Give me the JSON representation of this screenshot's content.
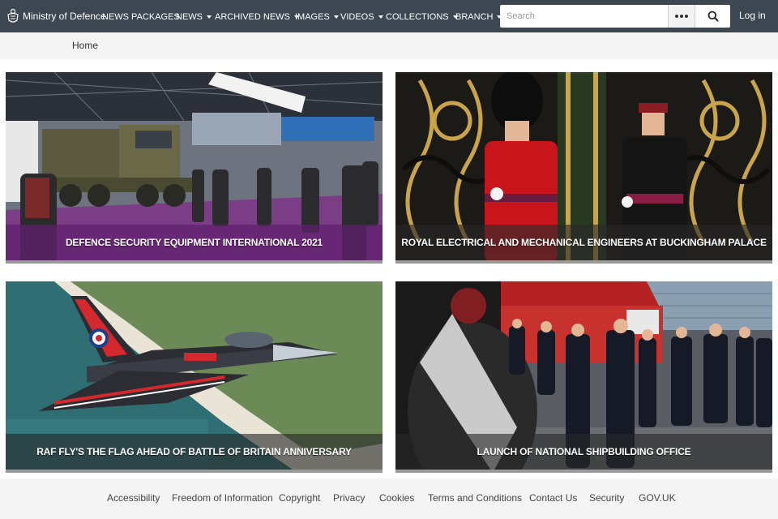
{
  "site": {
    "name": "Ministry of Defence"
  },
  "nav": {
    "items": [
      {
        "label": "NEWS PACKAGES",
        "dropdown": false
      },
      {
        "label": "NEWS",
        "dropdown": true
      },
      {
        "label": "ARCHIVED NEWS",
        "dropdown": true
      },
      {
        "label": "IMAGES",
        "dropdown": true
      },
      {
        "label": "VIDEOS",
        "dropdown": true
      },
      {
        "label": "COLLECTIONS",
        "dropdown": true
      },
      {
        "label": "BRANCH",
        "dropdown": true
      }
    ],
    "login": "Log in"
  },
  "search": {
    "placeholder": "Search",
    "value": ""
  },
  "breadcrumb": {
    "home": "Home"
  },
  "cards": [
    {
      "title": "DEFENCE SECURITY EQUIPMENT INTERNATIONAL 2021"
    },
    {
      "title": "ROYAL ELECTRICAL AND MECHANICAL ENGINEERS AT BUCKINGHAM PALACE"
    },
    {
      "title": "RAF FLY'S THE FLAG AHEAD OF BATTLE OF BRITAIN ANNIVERSARY"
    },
    {
      "title": "LAUNCH OF NATIONAL SHIPBUILDING OFFICE"
    }
  ],
  "footer": {
    "links": [
      "Accessibility",
      "Freedom of Information",
      "Copyright",
      "Privacy",
      "Cookies",
      "Terms and Conditions",
      "Contact Us",
      "Security",
      "GOV.UK"
    ]
  },
  "colors": {
    "navbar": "#3d4752",
    "background": "#f4f4f4",
    "caption_purple": "#5f1e6e"
  }
}
